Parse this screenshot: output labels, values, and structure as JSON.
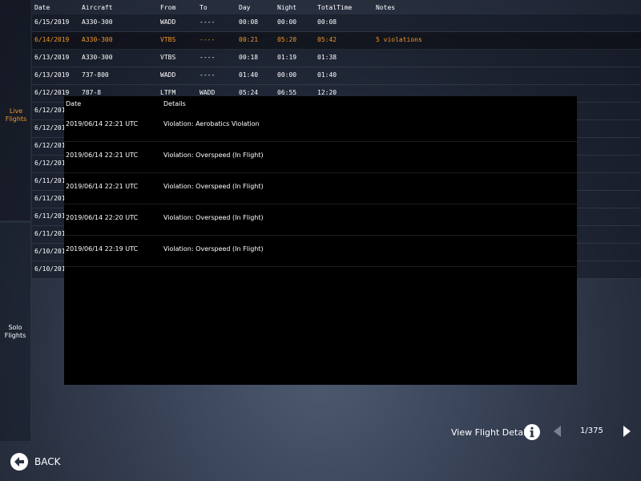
{
  "sidebar": {
    "live_flights": "Live Flights",
    "solo_flights": "Solo Flights"
  },
  "logbook": {
    "headers": {
      "date": "Date",
      "aircraft": "Aircraft",
      "from": "From",
      "to": "To",
      "day": "Day",
      "night": "Night",
      "total": "TotalTime",
      "notes": "Notes"
    },
    "rows": [
      {
        "date": "6/15/2019",
        "aircraft": "A330-300",
        "from": "WADD",
        "to": "----",
        "day": "00:08",
        "night": "00:00",
        "total": "00:08",
        "notes": ""
      },
      {
        "date": "6/14/2019",
        "aircraft": "A330-300",
        "from": "VTBS",
        "to": "----",
        "day": "00:21",
        "night": "05:20",
        "total": "05:42",
        "notes": "5 violations"
      },
      {
        "date": "6/13/2019",
        "aircraft": "A330-300",
        "from": "VTBS",
        "to": "----",
        "day": "00:18",
        "night": "01:19",
        "total": "01:38",
        "notes": ""
      },
      {
        "date": "6/13/2019",
        "aircraft": "737-800",
        "from": "WADD",
        "to": "----",
        "day": "01:40",
        "night": "00:00",
        "total": "01:40",
        "notes": ""
      },
      {
        "date": "6/12/2019",
        "aircraft": "787-8",
        "from": "LTFM",
        "to": "WADD",
        "day": "05:24",
        "night": "06:55",
        "total": "12:20",
        "notes": ""
      },
      {
        "date": "6/12/201",
        "aircraft": "",
        "from": "",
        "to": "",
        "day": "",
        "night": "",
        "total": "",
        "notes": ""
      },
      {
        "date": "6/12/201",
        "aircraft": "",
        "from": "",
        "to": "",
        "day": "",
        "night": "",
        "total": "",
        "notes": ""
      },
      {
        "date": "6/12/201",
        "aircraft": "",
        "from": "",
        "to": "",
        "day": "",
        "night": "",
        "total": "",
        "notes": ""
      },
      {
        "date": "6/12/201",
        "aircraft": "",
        "from": "",
        "to": "",
        "day": "",
        "night": "",
        "total": "",
        "notes": ""
      },
      {
        "date": "6/11/201",
        "aircraft": "",
        "from": "",
        "to": "",
        "day": "",
        "night": "",
        "total": "",
        "notes": ""
      },
      {
        "date": "6/11/201",
        "aircraft": "",
        "from": "",
        "to": "",
        "day": "",
        "night": "",
        "total": "",
        "notes": ""
      },
      {
        "date": "6/11/201",
        "aircraft": "",
        "from": "",
        "to": "",
        "day": "",
        "night": "",
        "total": "",
        "notes": ""
      },
      {
        "date": "6/11/201",
        "aircraft": "",
        "from": "",
        "to": "",
        "day": "",
        "night": "",
        "total": "",
        "notes": ""
      },
      {
        "date": "6/10/201",
        "aircraft": "",
        "from": "",
        "to": "",
        "day": "",
        "night": "",
        "total": "",
        "notes": ""
      },
      {
        "date": "6/10/201",
        "aircraft": "",
        "from": "",
        "to": "",
        "day": "",
        "night": "",
        "total": "",
        "notes": ""
      }
    ]
  },
  "popup": {
    "headers": {
      "date": "Date",
      "details": "Details"
    },
    "rows": [
      {
        "date": "2019/06/14 22:21 UTC",
        "details": "Violation: Aerobatics Violation"
      },
      {
        "date": "2019/06/14 22:21 UTC",
        "details": "Violation: Overspeed (In Flight)"
      },
      {
        "date": "2019/06/14 22:21 UTC",
        "details": "Violation: Overspeed (In Flight)"
      },
      {
        "date": "2019/06/14 22:20 UTC",
        "details": "Violation: Overspeed (In Flight)"
      },
      {
        "date": "2019/06/14 22:19 UTC",
        "details": "Violation: Overspeed (In Flight)"
      }
    ]
  },
  "footer": {
    "view_details": "View Flight Details",
    "page": "1/375",
    "back": "BACK"
  },
  "icons": {
    "info": "info-icon",
    "prev": "chevron-left-icon",
    "next": "chevron-right-icon",
    "back": "arrow-left-circle-icon"
  },
  "colors": {
    "accent": "#f0962a",
    "popup_bg": "#000000"
  }
}
